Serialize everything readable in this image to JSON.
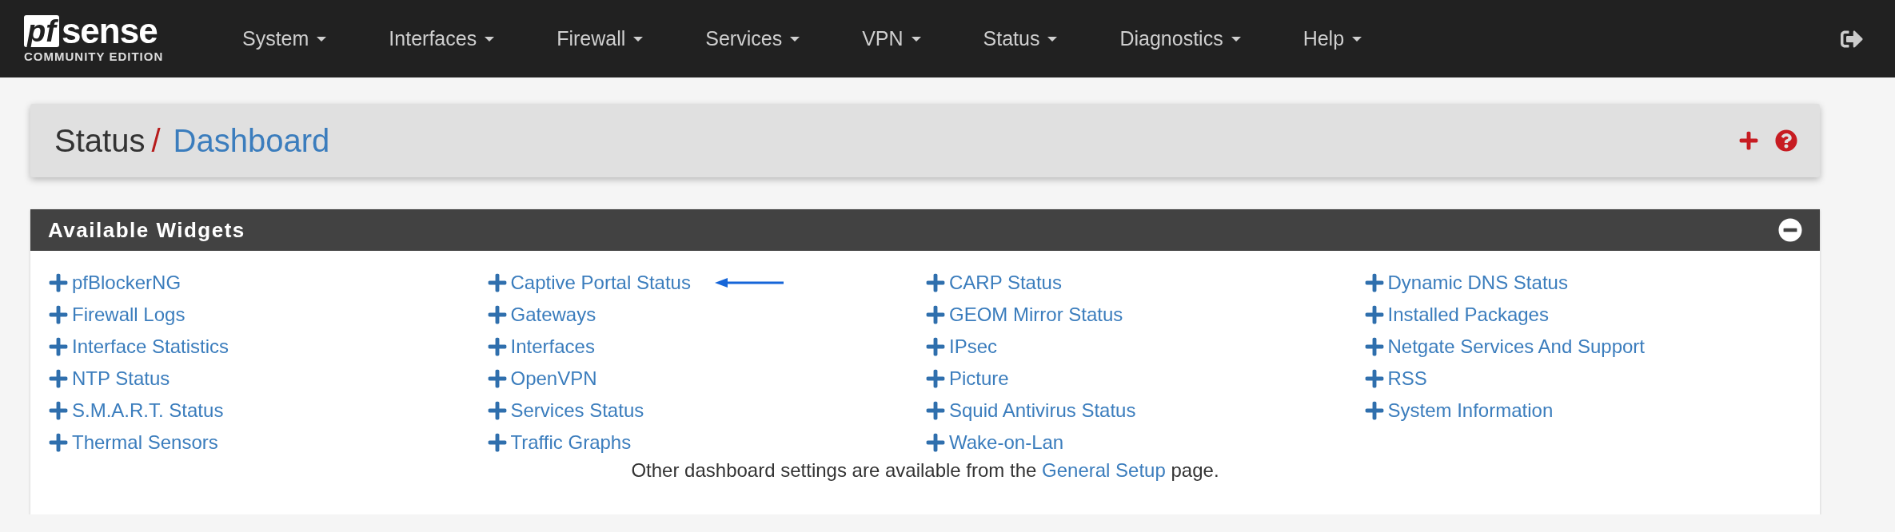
{
  "logo": {
    "mark": "pf",
    "name": "sense",
    "edition": "COMMUNITY EDITION"
  },
  "nav": [
    {
      "label": "System",
      "dropdown": true
    },
    {
      "label": "Interfaces",
      "dropdown": true
    },
    {
      "label": "Firewall",
      "dropdown": true
    },
    {
      "label": "Services",
      "dropdown": true
    },
    {
      "label": "VPN",
      "dropdown": true
    },
    {
      "label": "Status",
      "dropdown": true
    },
    {
      "label": "Diagnostics",
      "dropdown": true
    },
    {
      "label": "Help",
      "dropdown": true
    }
  ],
  "breadcrumb": {
    "section": "Status",
    "separator": "/",
    "page": "Dashboard"
  },
  "widgets_panel": {
    "title": "Available Widgets",
    "expanded": true,
    "columns": [
      [
        {
          "label": "pfBlockerNG",
          "arrow": false
        },
        {
          "label": "Firewall Logs",
          "arrow": false
        },
        {
          "label": "Interface Statistics",
          "arrow": false
        },
        {
          "label": "NTP Status",
          "arrow": false
        },
        {
          "label": "S.M.A.R.T. Status",
          "arrow": false
        },
        {
          "label": "Thermal Sensors",
          "arrow": false
        }
      ],
      [
        {
          "label": "Captive Portal Status",
          "arrow": true
        },
        {
          "label": "Gateways",
          "arrow": false
        },
        {
          "label": "Interfaces",
          "arrow": false
        },
        {
          "label": "OpenVPN",
          "arrow": false
        },
        {
          "label": "Services Status",
          "arrow": false
        },
        {
          "label": "Traffic Graphs",
          "arrow": false
        }
      ],
      [
        {
          "label": "CARP Status",
          "arrow": false
        },
        {
          "label": "GEOM Mirror Status",
          "arrow": false
        },
        {
          "label": "IPsec",
          "arrow": false
        },
        {
          "label": "Picture",
          "arrow": false
        },
        {
          "label": "Squid Antivirus Status",
          "arrow": false
        },
        {
          "label": "Wake-on-Lan",
          "arrow": false
        }
      ],
      [
        {
          "label": "Dynamic DNS Status",
          "arrow": false
        },
        {
          "label": "Installed Packages",
          "arrow": false
        },
        {
          "label": "Netgate Services And Support",
          "arrow": false
        },
        {
          "label": "RSS",
          "arrow": false
        },
        {
          "label": "System Information",
          "arrow": false
        }
      ]
    ],
    "note": {
      "before": "Other dashboard settings are available from the",
      "link": "General Setup",
      "after": "page."
    }
  }
}
